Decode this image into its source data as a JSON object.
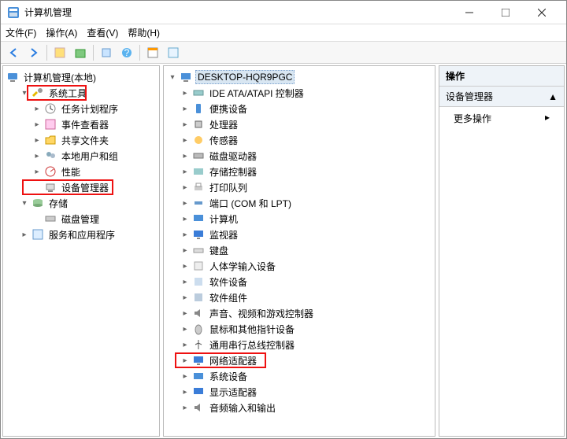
{
  "window": {
    "title": "计算机管理"
  },
  "menubar": {
    "file": "文件(F)",
    "action": "操作(A)",
    "view": "查看(V)",
    "help": "帮助(H)"
  },
  "left_tree": {
    "root": "计算机管理(本地)",
    "system_tools": "系统工具",
    "task_scheduler": "任务计划程序",
    "event_viewer": "事件查看器",
    "shared_folders": "共享文件夹",
    "local_users": "本地用户和组",
    "performance": "性能",
    "device_manager": "设备管理器",
    "storage": "存储",
    "disk_management": "磁盘管理",
    "services_apps": "服务和应用程序"
  },
  "mid_tree": {
    "root": "DESKTOP-HQR9PGC",
    "ide": "IDE ATA/ATAPI 控制器",
    "portable": "便携设备",
    "cpu": "处理器",
    "sensor": "传感器",
    "disk_drives": "磁盘驱动器",
    "storage_ctrl": "存储控制器",
    "print_queue": "打印队列",
    "ports": "端口 (COM 和 LPT)",
    "computer": "计算机",
    "monitor": "监视器",
    "keyboard": "键盘",
    "hid": "人体学输入设备",
    "soft_dev": "软件设备",
    "soft_comp": "软件组件",
    "sound": "声音、视频和游戏控制器",
    "mouse": "鼠标和其他指针设备",
    "usb": "通用串行总线控制器",
    "network": "网络适配器",
    "system_dev": "系统设备",
    "display": "显示适配器",
    "audio_io": "音频输入和输出"
  },
  "actions": {
    "header": "操作",
    "sub": "设备管理器",
    "more": "更多操作"
  }
}
